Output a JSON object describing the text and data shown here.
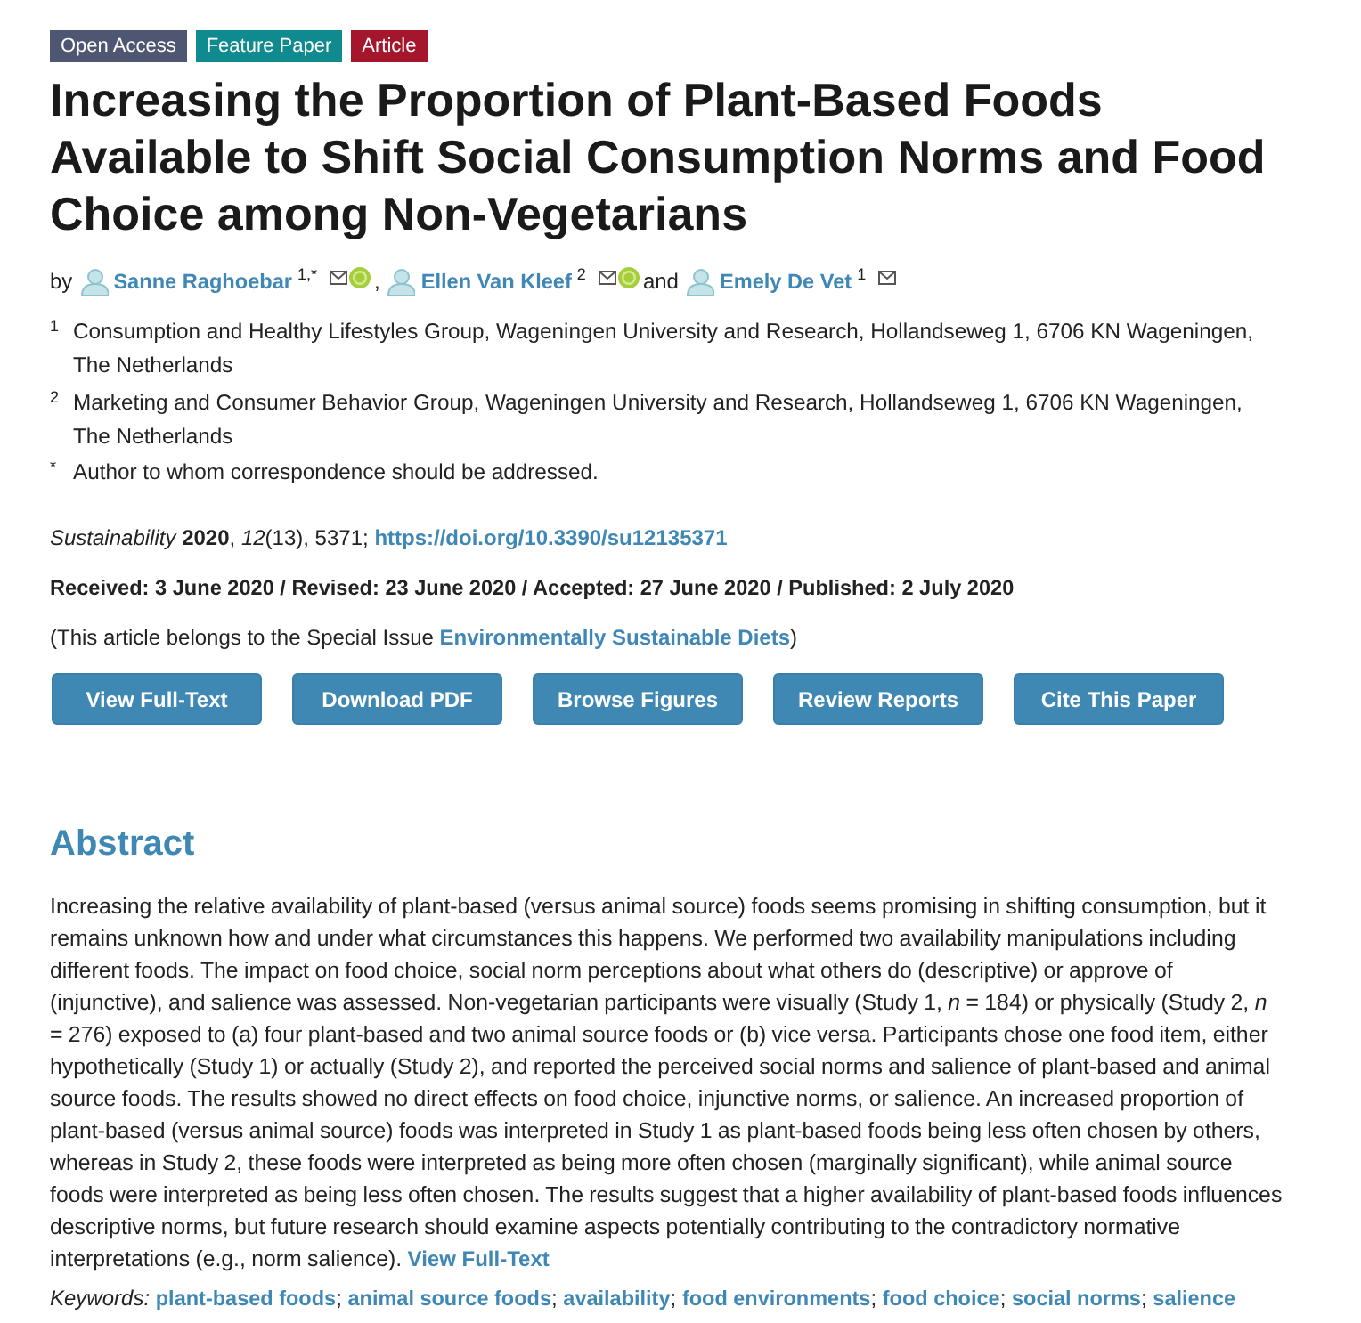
{
  "badges": [
    {
      "label": "Open Access",
      "color": "#4f5671"
    },
    {
      "label": "Feature Paper",
      "color": "#0f8a8f"
    },
    {
      "label": "Article",
      "color": "#a3162c"
    }
  ],
  "title": "Increasing the Proportion of Plant-Based Foods Available to Shift Social Consumption Norms and Food Choice among Non-Vegetarians",
  "authors": [
    {
      "lead": "by",
      "name": "Sanne Raghoebar",
      "affiliation": "1,*",
      "orcid": true
    },
    {
      "lead": ",",
      "name": "Ellen Van Kleef",
      "affiliation": "2",
      "orcid": true
    },
    {
      "lead": "and",
      "name": "Emely De Vet",
      "affiliation": "1",
      "orcid": false
    }
  ],
  "affiliations": [
    {
      "marker": "1",
      "text": "Consumption and Healthy Lifestyles Group, Wageningen University and Research, Hollandseweg 1, 6706 KN Wageningen, The Netherlands"
    },
    {
      "marker": "2",
      "text": "Marketing and Consumer Behavior Group, Wageningen University and Research, Hollandseweg 1, 6706 KN Wageningen, The Netherlands"
    },
    {
      "marker": "*",
      "text": "Author to whom correspondence should be addressed."
    }
  ],
  "citation": {
    "text": "*Sustainability* **2020**, *12*(13), 5371;",
    "doi": "https://doi.org/10.3390/su12135371"
  },
  "dates": "Received: 3 June 2020 / Revised: 23 June 2020 / Accepted: 27 June 2020 / Published: 2 July 2020",
  "special_issue": {
    "before": "(This article belongs to the Special Issue",
    "link": "Environmentally Sustainable Diets",
    "after": ")"
  },
  "buttons": [
    "View Full-Text",
    "Download PDF",
    "Browse Figures",
    "Review Reports",
    "Cite This Paper"
  ],
  "abstract": {
    "heading": "Abstract",
    "text": "Increasing the relative availability of plant-based (versus animal source) foods seems promising in shifting consumption, but it remains unknown how and under what circumstances this happens. We performed two availability manipulations including different foods. The impact on food choice, social norm perceptions about what others do (descriptive) or approve of (injunctive), and salience was assessed. Non-vegetarian participants were visually (Study 1, *n* = 184) or physically (Study 2, *n* = 276) exposed to (a) four plant-based and two animal source foods or (b) vice versa. Participants chose one food item, either hypothetically (Study 1) or actually (Study 2), and reported the perceived social norms and salience of plant-based and animal source foods. The results showed no direct effects on food choice, injunctive norms, or salience. An increased proportion of plant-based (versus animal source) foods was interpreted in Study 1 as plant-based foods being less often chosen by others, whereas in Study 2, these foods were interpreted as being more often chosen (marginally significant), while animal source foods were interpreted as being less often chosen. The results suggest that a higher availability of plant-based foods influences descriptive norms, but future research should examine aspects potentially contributing to the contradictory normative interpretations (e.g., norm salience).",
    "link": "View Full-Text"
  },
  "keywords": {
    "label": "Keywords:",
    "separator": ";",
    "items": [
      "plant-based foods",
      "animal source foods",
      "availability",
      "food environments",
      "food choice",
      "social norms",
      "salience"
    ]
  }
}
